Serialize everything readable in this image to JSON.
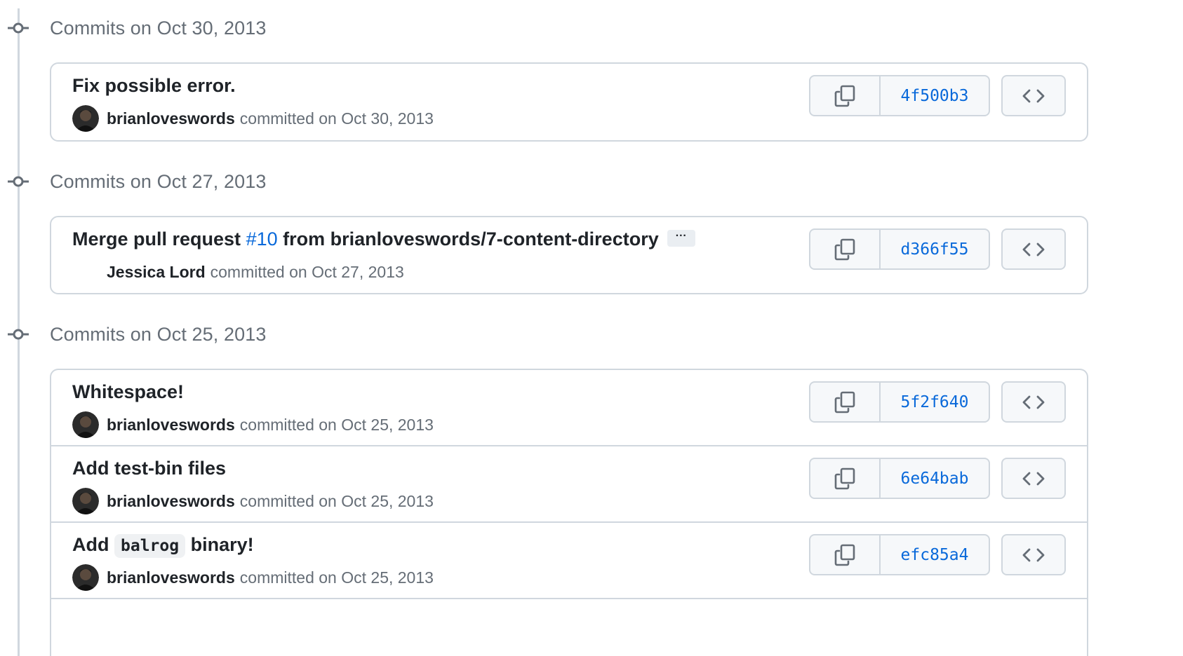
{
  "groups": [
    {
      "title": "Commits on Oct 30, 2013",
      "commits": [
        {
          "message": "Fix possible error.",
          "author": "brianloveswords",
          "committed": "committed on Oct 30, 2013",
          "sha": "4f500b3"
        }
      ]
    },
    {
      "title": "Commits on Oct 27, 2013",
      "commits": [
        {
          "message_prefix": "Merge pull request ",
          "message_link": "#10",
          "message_suffix": " from brianloveswords/7-content-directory",
          "ellipsis": "···",
          "author": "Jessica Lord",
          "committed": "committed on Oct 27, 2013",
          "sha": "d366f55"
        }
      ]
    },
    {
      "title": "Commits on Oct 25, 2013",
      "commits": [
        {
          "message": "Whitespace!",
          "author": "brianloveswords",
          "committed": "committed on Oct 25, 2013",
          "sha": "5f2f640"
        },
        {
          "message": "Add test-bin files",
          "author": "brianloveswords",
          "committed": "committed on Oct 25, 2013",
          "sha": "6e64bab"
        },
        {
          "message_prefix": "Add ",
          "message_code": "balrog",
          "message_suffix": " binary!",
          "author": "brianloveswords",
          "committed": "committed on Oct 25, 2013",
          "sha": "efc85a4"
        }
      ]
    }
  ],
  "icons": {
    "commit_node": "git-commit-icon",
    "copy": "copy-icon",
    "browse": "code-icon"
  },
  "colors": {
    "link": "#0969da",
    "muted": "#656d76",
    "border": "#d0d7de",
    "button_bg": "#f6f8fa"
  }
}
